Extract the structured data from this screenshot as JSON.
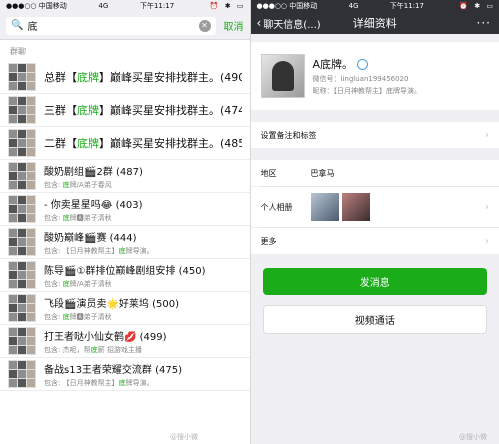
{
  "left": {
    "status": {
      "carrier": "●●●○○ 中国移动",
      "network": "4G",
      "time": "下午11:17",
      "alarm": "⏰",
      "bluetooth": "✱",
      "battery": "▭"
    },
    "search": {
      "query": "底",
      "cancel": "取消"
    },
    "section_header": "群聊",
    "groups": [
      {
        "pre": "总群【",
        "hl": "底牌",
        "post": "】巅峰买星安排找群主。(490)",
        "desc": ""
      },
      {
        "pre": "三群【",
        "hl": "底牌",
        "post": "】巅峰买星安排找群主。(474)",
        "desc": ""
      },
      {
        "pre": "二群【",
        "hl": "底牌",
        "post": "】巅峰买星安排找群主。(485)",
        "desc": ""
      },
      {
        "pre": "酸奶剧组🎬2群 (487)",
        "hl": "",
        "post": "",
        "desc_pre": "包含: ",
        "desc_hl": "底",
        "desc_post": "牌/A弟子春风"
      },
      {
        "pre": "-   你卖星星吗😂 (403)",
        "hl": "",
        "post": "",
        "desc_pre": "包含: ",
        "desc_hl": "底",
        "desc_post": "牌🅰弟子清秋"
      },
      {
        "pre": "酸奶巅峰🎬赛 (444)",
        "hl": "",
        "post": "",
        "desc_pre": "包含: 【日月神教帮主】",
        "desc_hl": "底",
        "desc_post": "牌导演。"
      },
      {
        "pre": "陈导🎬①群排位巅峰剧组安排 (450)",
        "hl": "",
        "post": "",
        "desc_pre": "包含: ",
        "desc_hl": "底",
        "desc_post": "牌/A弟子清秋"
      },
      {
        "pre": "飞段🎬演员卖🌟好莱坞 (500)",
        "hl": "",
        "post": "",
        "desc_pre": "包含: ",
        "desc_hl": "底",
        "desc_post": "牌🅰弟子清秋"
      },
      {
        "pre": "打王者哒小仙女鹤💋 (499)",
        "hl": "",
        "post": "",
        "desc_pre": "包含: 杰呢，帮",
        "desc_hl": "底",
        "desc_post": "薪 招游戏主播"
      },
      {
        "pre": "备战s13王者荣耀交流群 (475)",
        "hl": "",
        "post": "",
        "desc_pre": "包含: 【日月神教帮主】",
        "desc_hl": "底",
        "desc_post": "牌导演。"
      }
    ],
    "watermark": "@搜小微"
  },
  "right": {
    "status": {
      "carrier": "●●●○○ 中国移动",
      "network": "4G",
      "time": "下午11:17",
      "alarm": "⏰",
      "bluetooth": "✱",
      "battery": "▭"
    },
    "nav": {
      "back": "聊天信息(...)",
      "title": "详细资料",
      "more": "···"
    },
    "profile": {
      "name": "A底牌。",
      "wechat_id": "微信号：lingluan199456020",
      "nickname": "昵称：【日月神教帮主】底牌导演。"
    },
    "cells": {
      "remark": "设置备注和标签",
      "region_label": "地区",
      "region_value": "巴拿马",
      "album_label": "个人相册",
      "more": "更多"
    },
    "buttons": {
      "send": "发消息",
      "video": "视频通话"
    },
    "watermark": "@搜小微"
  }
}
